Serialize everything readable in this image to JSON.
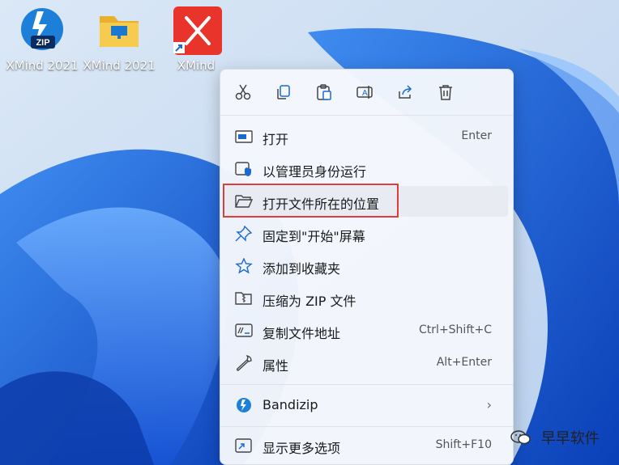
{
  "desktop": {
    "icons": [
      {
        "label": "XMind 2021",
        "icon": "bandizip-zip-icon"
      },
      {
        "label": "XMind 2021",
        "icon": "folder-icon"
      },
      {
        "label": "XMind",
        "icon": "xmind-app-shortcut-icon"
      }
    ]
  },
  "context_menu": {
    "toolbar": [
      {
        "icon": "cut-icon"
      },
      {
        "icon": "copy-icon"
      },
      {
        "icon": "paste-icon"
      },
      {
        "icon": "rename-icon"
      },
      {
        "icon": "share-icon"
      },
      {
        "icon": "delete-icon"
      }
    ],
    "items": [
      {
        "label": "打开",
        "shortcut": "Enter",
        "icon": "open-icon"
      },
      {
        "label": "以管理员身份运行",
        "shortcut": "",
        "icon": "run-as-admin-shield-icon"
      },
      {
        "label": "打开文件所在的位置",
        "shortcut": "",
        "icon": "folder-open-icon"
      },
      {
        "label": "固定到\"开始\"屏幕",
        "shortcut": "",
        "icon": "pin-icon"
      },
      {
        "label": "添加到收藏夹",
        "shortcut": "",
        "icon": "star-icon"
      },
      {
        "label": "压缩为 ZIP 文件",
        "shortcut": "",
        "icon": "zip-folder-icon"
      },
      {
        "label": "复制文件地址",
        "shortcut": "Ctrl+Shift+C",
        "icon": "copy-path-icon"
      },
      {
        "label": "属性",
        "shortcut": "Alt+Enter",
        "icon": "wrench-icon"
      },
      {
        "label": "Bandizip",
        "shortcut": "",
        "submenu": "›",
        "icon": "bandizip-icon"
      },
      {
        "label": "显示更多选项",
        "shortcut": "Shift+F10",
        "icon": "more-options-icon"
      }
    ]
  },
  "watermark": {
    "text": "早早软件"
  },
  "colors": {
    "accent": "#0067c0",
    "highlight_border": "#e03c3c",
    "wallpaper": "#1e6fe0"
  }
}
